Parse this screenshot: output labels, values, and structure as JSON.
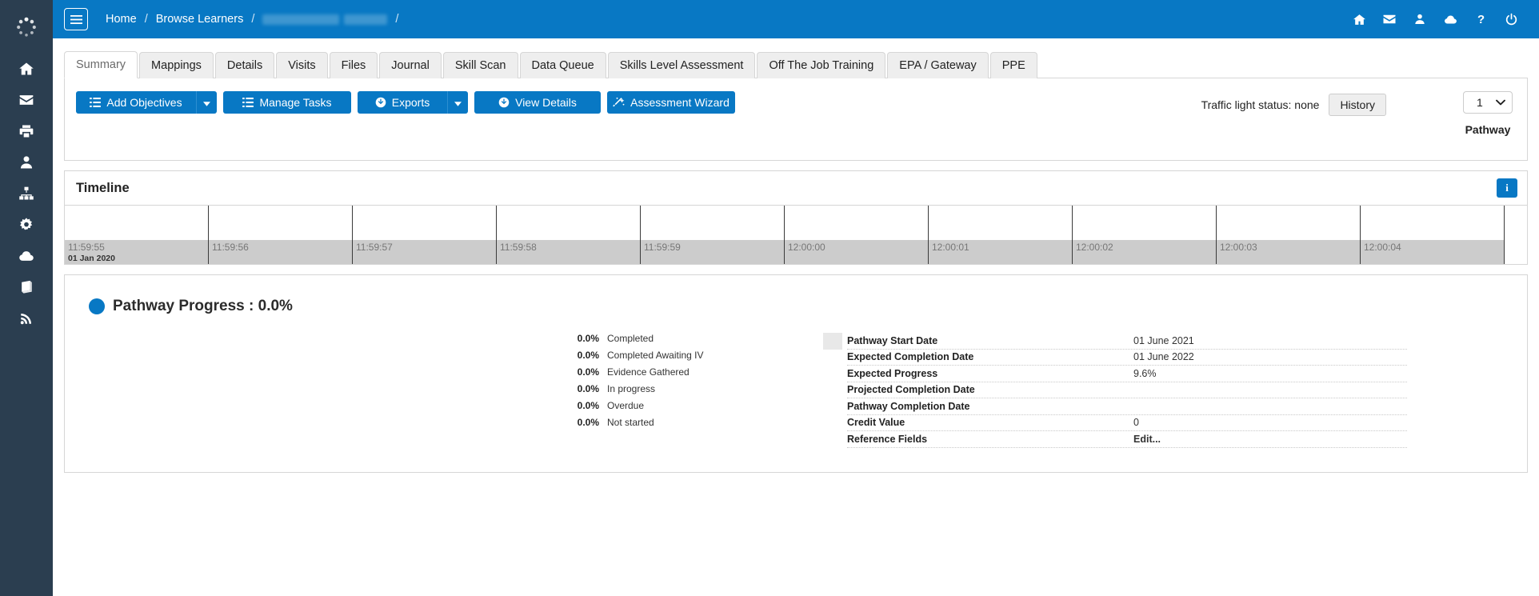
{
  "theme": {
    "brand_blue": "#0878c4",
    "sidebar_bg": "#2b3e50",
    "tab_inactive_bg": "#eeeeee",
    "timeline_axis_bg": "#cccccc"
  },
  "sidebar": {
    "logo_icon": "spinner-logo-icon",
    "items": [
      {
        "icon": "home-icon",
        "name": "home"
      },
      {
        "icon": "envelope-icon",
        "name": "messages"
      },
      {
        "icon": "printer-icon",
        "name": "print"
      },
      {
        "icon": "user-icon",
        "name": "profile"
      },
      {
        "icon": "sitemap-icon",
        "name": "structure"
      },
      {
        "icon": "gear-icon",
        "name": "settings"
      },
      {
        "icon": "cloud-icon",
        "name": "cloud"
      },
      {
        "icon": "book-icon",
        "name": "library"
      },
      {
        "icon": "rss-icon",
        "name": "feed"
      }
    ]
  },
  "topbar": {
    "menu_toggle_label": "menu",
    "breadcrumb": [
      {
        "label": "Home",
        "redacted": false
      },
      {
        "label": "Browse Learners",
        "redacted": false
      },
      {
        "label": "",
        "redacted": true
      }
    ],
    "separator": "/",
    "icons": [
      {
        "icon": "home-icon",
        "name": "home"
      },
      {
        "icon": "envelope-icon",
        "name": "mail"
      },
      {
        "icon": "user-icon",
        "name": "account"
      },
      {
        "icon": "cloud-icon",
        "name": "cloud"
      },
      {
        "icon": "question-icon",
        "name": "help"
      },
      {
        "icon": "power-icon",
        "name": "logout"
      }
    ]
  },
  "tabs": [
    {
      "label": "Summary",
      "active": true
    },
    {
      "label": "Mappings",
      "active": false
    },
    {
      "label": "Details",
      "active": false
    },
    {
      "label": "Visits",
      "active": false
    },
    {
      "label": "Files",
      "active": false
    },
    {
      "label": "Journal",
      "active": false
    },
    {
      "label": "Skill Scan",
      "active": false
    },
    {
      "label": "Data Queue",
      "active": false
    },
    {
      "label": "Skills Level Assessment",
      "active": false
    },
    {
      "label": "Off The Job Training",
      "active": false
    },
    {
      "label": "EPA / Gateway",
      "active": false
    },
    {
      "label": "PPE",
      "active": false
    }
  ],
  "toolbar": {
    "add_objectives_label": "Add Objectives",
    "add_objectives_icon": "list-icon",
    "manage_tasks_label": "Manage Tasks",
    "manage_tasks_icon": "list-icon",
    "exports_label": "Exports",
    "exports_icon": "download-circle-icon",
    "view_details_label": "View Details",
    "view_details_icon": "download-circle-icon",
    "assessment_wizard_label": "Assessment Wizard",
    "assessment_wizard_icon": "magic-wand-icon",
    "caret_icon": "chevron-down-icon",
    "traffic_light_text": "Traffic light status: none",
    "history_label": "History",
    "pathway_selected": "1",
    "pathway_options": [
      "1"
    ],
    "pathway_label": "Pathway"
  },
  "timeline": {
    "title": "Timeline",
    "info_label": "i",
    "start_date": "01 Jan 2020",
    "ticks": [
      "11:59:55",
      "11:59:56",
      "11:59:57",
      "11:59:58",
      "11:59:59",
      "12:00:00",
      "12:00:01",
      "12:00:02",
      "12:00:03",
      "12:00:04"
    ]
  },
  "progress": {
    "title": "Pathway Progress : 0.0%",
    "dot_color": "#0878c4",
    "legend": [
      {
        "pct": "0.0%",
        "label": "Completed"
      },
      {
        "pct": "0.0%",
        "label": "Completed Awaiting IV"
      },
      {
        "pct": "0.0%",
        "label": "Evidence Gathered"
      },
      {
        "pct": "0.0%",
        "label": "In progress"
      },
      {
        "pct": "0.0%",
        "label": "Overdue"
      },
      {
        "pct": "0.0%",
        "label": "Not started"
      }
    ],
    "swatches": [
      "#6f7a1e",
      "#bcc34b",
      "#dde07c",
      "#0880c4",
      "#c83b53",
      "#ecede6"
    ],
    "details": [
      {
        "label": "Pathway Start Date",
        "value": "01 June 2021",
        "bold": false
      },
      {
        "label": "Expected Completion Date",
        "value": "01 June 2022",
        "bold": false
      },
      {
        "label": "Expected Progress",
        "value": "9.6%",
        "bold": false
      },
      {
        "label": "Projected Completion Date",
        "value": "",
        "bold": false
      },
      {
        "label": "Pathway Completion Date",
        "value": "",
        "bold": false
      },
      {
        "label": "Credit Value",
        "value": "0",
        "bold": false
      },
      {
        "label": "Reference Fields",
        "value": "Edit...",
        "bold": true
      }
    ]
  },
  "chart_data": {
    "type": "pie",
    "title": "Pathway Progress : 0.0%",
    "categories": [
      "Completed",
      "Completed Awaiting IV",
      "Evidence Gathered",
      "In progress",
      "Overdue",
      "Not started"
    ],
    "values": [
      0.0,
      0.0,
      0.0,
      0.0,
      0.0,
      0.0
    ],
    "colors": [
      "#6f7a1e",
      "#bcc34b",
      "#dde07c",
      "#0880c4",
      "#c83b53",
      "#ecede6"
    ],
    "unit": "%",
    "legend_position": "center",
    "overall_progress": 0.0,
    "expected_progress": 9.6
  }
}
